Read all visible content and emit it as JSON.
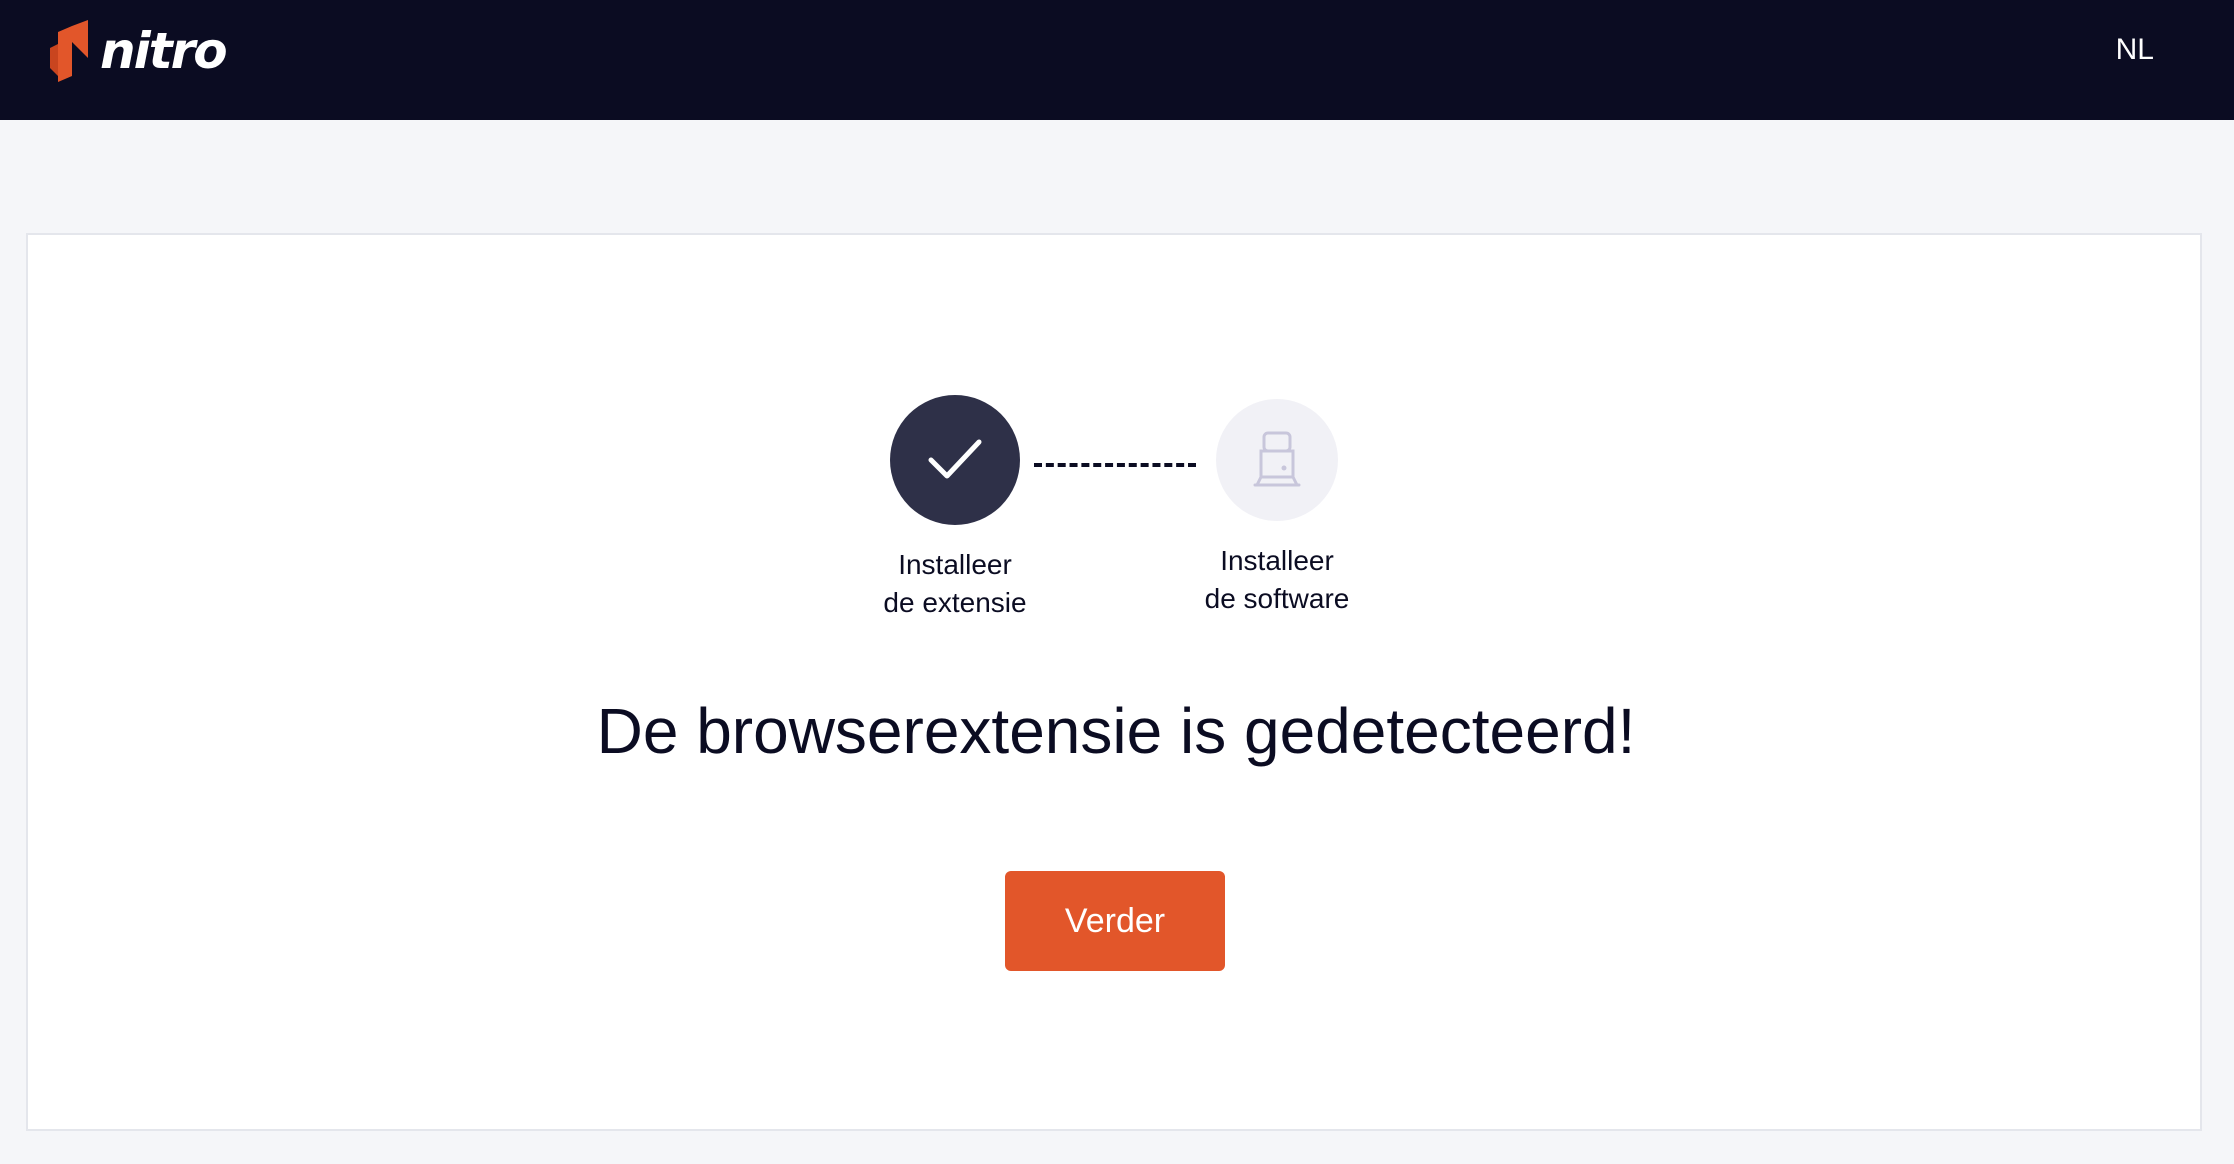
{
  "header": {
    "logo_text": "nitro",
    "language_label": "NL"
  },
  "steps": [
    {
      "line1": "Installeer",
      "line2": "de extensie",
      "icon": "check-icon",
      "status": "completed"
    },
    {
      "line1": "Installeer",
      "line2": "de software",
      "icon": "computer-icon",
      "status": "pending"
    }
  ],
  "main": {
    "headline": "De browserextensie is gedetecteerd!",
    "continue_label": "Verder"
  },
  "colors": {
    "topbar": "#0b0c22",
    "brand_orange": "#e2562a",
    "step_completed": "#2e3048",
    "step_pending": "#f1f1f6",
    "page_background": "#f5f6f9"
  }
}
